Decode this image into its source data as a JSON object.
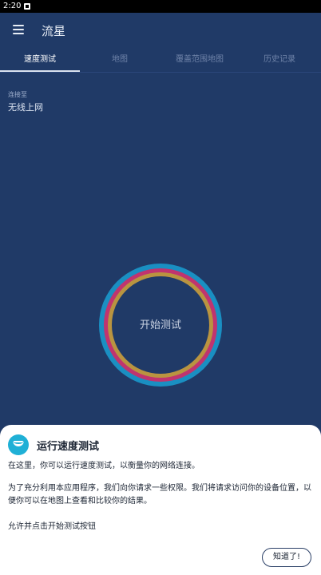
{
  "status_bar": {
    "time": "2:20"
  },
  "app_bar": {
    "title": "流星"
  },
  "tabs": [
    {
      "label": "速度测试",
      "active": true
    },
    {
      "label": "地图",
      "active": false
    },
    {
      "label": "覆盖范围地图",
      "active": false
    },
    {
      "label": "历史记录",
      "active": false
    }
  ],
  "connection": {
    "label": "连接至",
    "value": "无线上网"
  },
  "speed_test": {
    "button_label": "开始测试",
    "ring_colors": [
      "#1a8fc2",
      "#c0346f",
      "#b99440"
    ]
  },
  "sheet": {
    "title": "运行速度测试",
    "paragraph1": "在这里，你可以运行速度测试，以衡量你的网络连接。",
    "paragraph2": "为了充分利用本应用程序，我们向你请求一些权限。我们将请求访问你的设备位置，以便你可以在地图上查看和比较你的结果。",
    "paragraph3": "允许并点击开始测试按钮",
    "button_label": "知道了!"
  },
  "colors": {
    "background": "#203a67",
    "accent": "#1fb0d6"
  }
}
